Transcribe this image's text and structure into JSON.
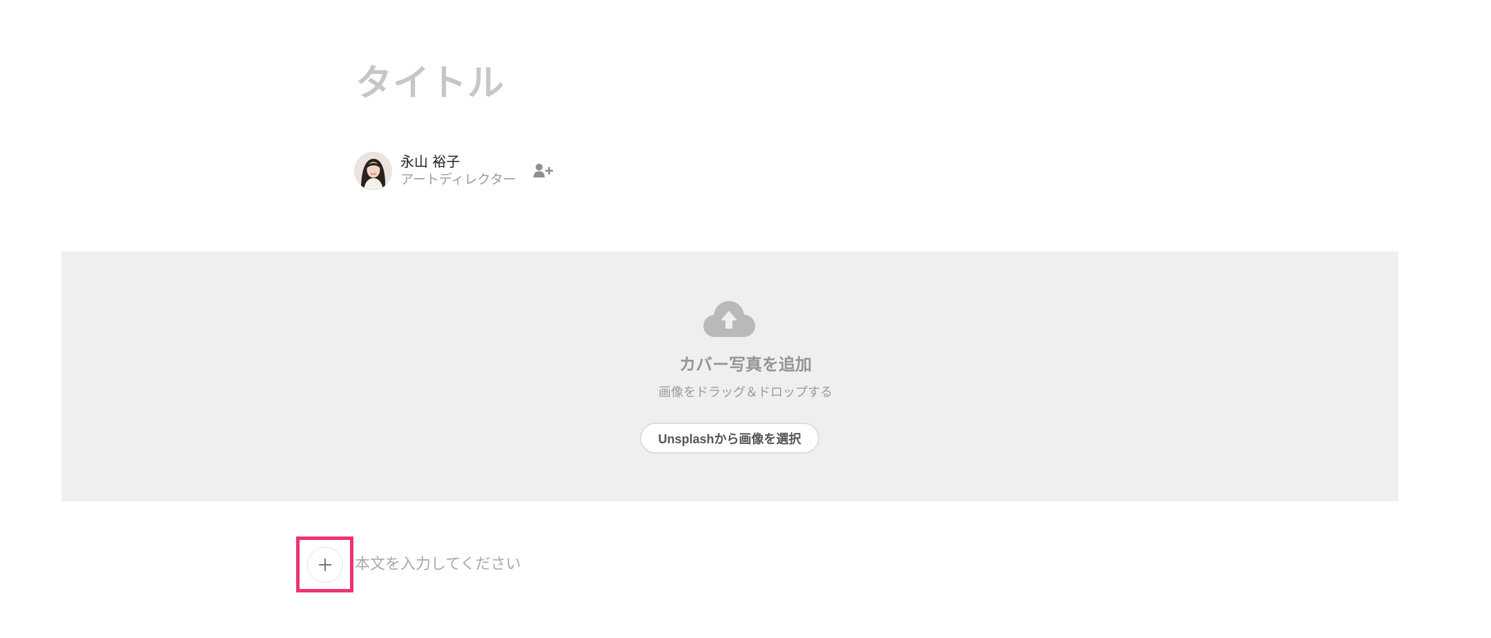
{
  "editor": {
    "title_placeholder": "タイトル",
    "body_placeholder": "本文を入力してください"
  },
  "author": {
    "name": "永山 裕子",
    "role": "アートディレクター",
    "add_author_icon": "user-plus-icon"
  },
  "cover": {
    "icon": "cloud-upload-icon",
    "title": "カバー写真を追加",
    "subtitle": "画像をドラッグ＆ドロップする",
    "unsplash_label": "Unsplashから画像を選択"
  },
  "add_block": {
    "icon": "plus-icon",
    "highlight_color": "#f0336e"
  },
  "colors": {
    "cover_background": "#efefef",
    "placeholder_text": "#c6c6c6"
  }
}
